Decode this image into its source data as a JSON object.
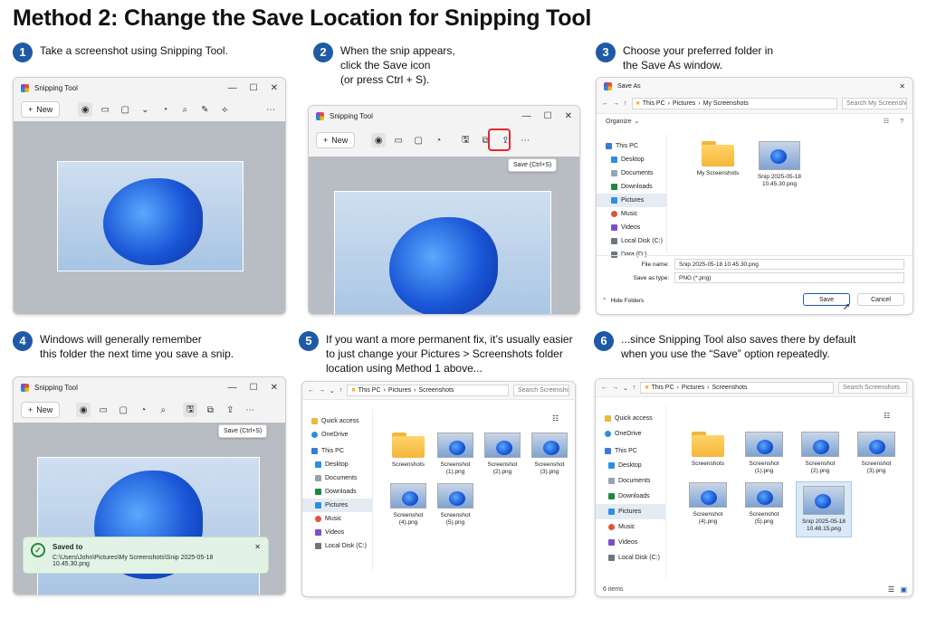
{
  "title": "Method 2: Change the Save Location for Snipping Tool",
  "steps": [
    {
      "num": "1",
      "lines": [
        "Take a screenshot using Snipping Tool."
      ]
    },
    {
      "num": "2",
      "lines": [
        "When the snip appears,",
        "click the Save icon",
        "(or press Ctrl + S)."
      ]
    },
    {
      "num": "3",
      "lines": [
        "Choose your preferred folder in",
        "the Save As window."
      ]
    },
    {
      "num": "4",
      "lines": [
        "Windows will generally remember",
        "this folder the next time you save a snip."
      ]
    },
    {
      "num": "5",
      "lines": [
        "If you want a more permanent fix, it’s usually easier",
        "to just change your Pictures > Screenshots folder",
        "location using Method 1 above..."
      ]
    },
    {
      "num": "6",
      "lines": [
        "...since Snipping Tool also saves there by default",
        "when you use the “Save” option repeatedly."
      ]
    }
  ],
  "snipping": {
    "app_title": "Snipping Tool",
    "new_label": "New",
    "new_icon": "plus-icon",
    "save_tooltip": "Save (Ctrl+S)"
  },
  "save_as": {
    "window_title": "Save As",
    "breadcrumb": [
      "This PC",
      "Pictures",
      "My Screenshots"
    ],
    "search_placeholder": "Search My Screenshots",
    "organize_label": "Organize",
    "nav_items": [
      "This PC",
      "Desktop",
      "Documents",
      "Downloads",
      "Pictures",
      "Music",
      "Videos",
      "Local Disk (C:)",
      "Data (D:)"
    ],
    "selected_nav": "Pictures",
    "files": [
      {
        "name": "My Screenshots",
        "kind": "folder"
      },
      {
        "name": "Snip 2025-05-18 10.45.30.png",
        "kind": "image"
      }
    ],
    "file_name_label": "File name:",
    "file_name_value": "Snip 2025-05-18 10.45.30.png",
    "save_type_label": "Save as type:",
    "save_type_value": "PNG (*.png)",
    "hide_folders_label": "Hide Folders",
    "save_button": "Save",
    "cancel_button": "Cancel"
  },
  "notification": {
    "heading": "Saved to",
    "path": "C:\\Users\\John\\Pictures\\My Screenshots\\Snip 2025-05-18 10.45.30.png"
  },
  "explorer5": {
    "breadcrumb": [
      "This PC",
      "Pictures",
      "Screenshots"
    ],
    "search_placeholder": "Search Screenshots",
    "nav_items": [
      "Quick access",
      "OneDrive",
      "This PC",
      "Desktop",
      "Documents",
      "Downloads",
      "Pictures",
      "Music",
      "Videos",
      "Local Disk (C:)"
    ],
    "selected_nav": "Pictures",
    "files": [
      {
        "name": "Screenshots",
        "kind": "folder"
      },
      {
        "name": "Screenshot (1).png",
        "kind": "image"
      },
      {
        "name": "Screenshot (2).png",
        "kind": "image"
      },
      {
        "name": "Screenshot (3).png",
        "kind": "image"
      },
      {
        "name": "Screenshot (4).png",
        "kind": "image"
      },
      {
        "name": "Screenshot (5).png",
        "kind": "image"
      }
    ]
  },
  "explorer6": {
    "breadcrumb": [
      "This PC",
      "Pictures",
      "Screenshots"
    ],
    "search_placeholder": "Search Screenshots",
    "nav_items": [
      "Quick access",
      "OneDrive",
      "This PC",
      "Desktop",
      "Documents",
      "Downloads",
      "Pictures",
      "Music",
      "Videos",
      "Local Disk (C:)"
    ],
    "selected_nav": "Pictures",
    "files": [
      {
        "name": "Screenshots",
        "kind": "folder"
      },
      {
        "name": "Screenshot (1).png",
        "kind": "image"
      },
      {
        "name": "Screenshot (2).png",
        "kind": "image"
      },
      {
        "name": "Screenshot (3).png",
        "kind": "image"
      },
      {
        "name": "Screenshot (4).png",
        "kind": "image"
      },
      {
        "name": "Screenshot (5).png",
        "kind": "image"
      },
      {
        "name": "Snip 2025-05-18 10.48.15.png",
        "kind": "image",
        "selected": true
      }
    ],
    "status": "6 items"
  },
  "colors": {
    "accent": "#1f5aa6",
    "highlight": "#e0282e",
    "success": "#1d8a3b"
  }
}
